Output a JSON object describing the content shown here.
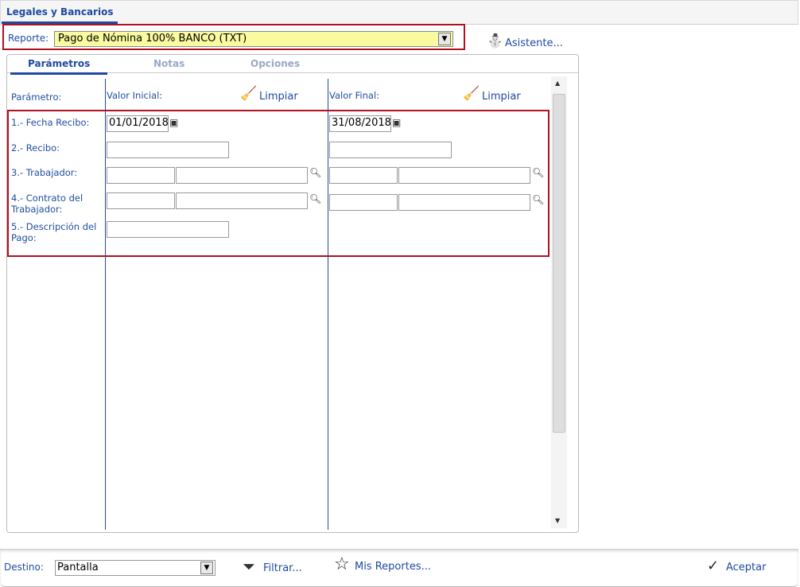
{
  "main_tab": "Legales y Bancarios",
  "report": {
    "label": "Reporte:",
    "value": "Pago de Nómina 100% BANCO (TXT)"
  },
  "wizard_label": "Asistente...",
  "tabs": [
    "Parámetros",
    "Notas",
    "Opciones"
  ],
  "headers": {
    "param": "Parámetro:",
    "initial": "Valor Inicial:",
    "final": "Valor Final:",
    "clear": "Limpiar"
  },
  "params": [
    {
      "label": "1.- Fecha Recibo:",
      "initial": "01/01/2018",
      "final": "31/08/2018"
    },
    {
      "label": "2.- Recibo:"
    },
    {
      "label": "3.- Trabajador:"
    },
    {
      "label": "4.- Contrato del Trabajador:"
    },
    {
      "label": "5.- Descripción del Pago:"
    }
  ],
  "footer": {
    "dest_label": "Destino:",
    "dest_value": "Pantalla",
    "filter": "Filtrar...",
    "my_reports": "Mis Reportes...",
    "accept": "Aceptar"
  }
}
